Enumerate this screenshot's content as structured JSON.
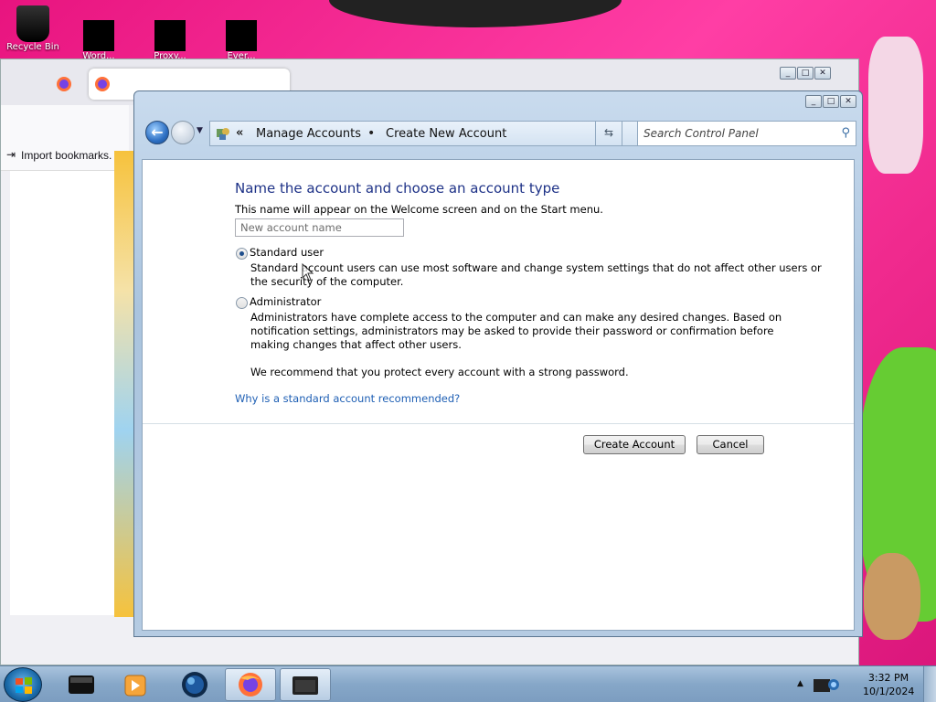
{
  "desktop": {
    "icons": [
      {
        "label": "Recycle Bin"
      },
      {
        "label": "Word..."
      },
      {
        "label": "Proxy..."
      },
      {
        "label": "Ever..."
      }
    ]
  },
  "browser": {
    "bookmarks_label": "Import bookmarks..."
  },
  "control_panel": {
    "breadcrumb": [
      "Manage Accounts",
      "Create New Account"
    ],
    "breadcrumb_overflow": "«",
    "breadcrumb_sep": "•",
    "search_placeholder": "Search Control Panel",
    "heading": "Name the account and choose an account type",
    "name_hint": "This name will appear on the Welcome screen and on the Start menu.",
    "name_placeholder": "New account name",
    "options": [
      {
        "label": "Standard user",
        "checked": true,
        "description_line1": "Standard account users can use most software and change system settings that do not affect other users or",
        "description_line2": "the security of the computer."
      },
      {
        "label": "Administrator",
        "checked": false,
        "description_line1": "Administrators have complete access to the computer and can make any desired changes. Based on",
        "description_line2": "notification settings, administrators may be asked to provide their password or confirmation before",
        "description_line3": "making changes that affect other users."
      }
    ],
    "recommend": "We recommend that you protect every account with a strong password.",
    "why_link": "Why is a standard account recommended?",
    "create_button": "Create Account",
    "cancel_button": "Cancel"
  },
  "taskbar": {
    "clock_time": "3:32 PM",
    "clock_date": "10/1/2024",
    "items": [
      "terminal",
      "media-player",
      "globe",
      "firefox",
      "control-panel"
    ]
  }
}
